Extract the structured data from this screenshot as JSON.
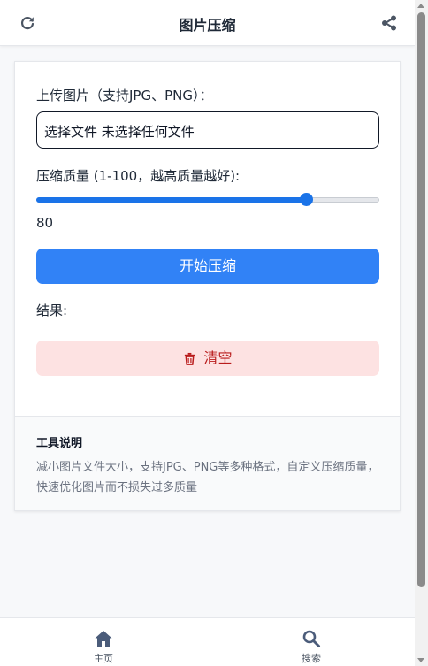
{
  "header": {
    "title": "图片压缩",
    "left_icon": "refresh-icon",
    "right_icon": "share-icon"
  },
  "form": {
    "upload_label": "上传图片（支持JPG、PNG）：",
    "file_input_text": "选择文件 未选择任何文件",
    "quality_label": "压缩质量 (1-100，越高质量越好):",
    "quality": {
      "value": "80",
      "min": 1,
      "max": 100
    },
    "compress_button": "开始压缩",
    "result_label": "结果:",
    "clear_button": "清空",
    "clear_icon": "trash-icon"
  },
  "info": {
    "title": "工具说明",
    "description": "减小图片文件大小，支持JPG、PNG等多种格式，自定义压缩质量，快速优化图片而不损失过多质量"
  },
  "bottom_nav": {
    "items": [
      {
        "label": "主页",
        "icon": "home-icon"
      },
      {
        "label": "搜索",
        "icon": "search-icon"
      }
    ]
  },
  "colors": {
    "primary": "#3182f6",
    "slider": "#1a73e8",
    "danger_bg": "#fde2e2",
    "danger_text": "#b91c1c"
  }
}
